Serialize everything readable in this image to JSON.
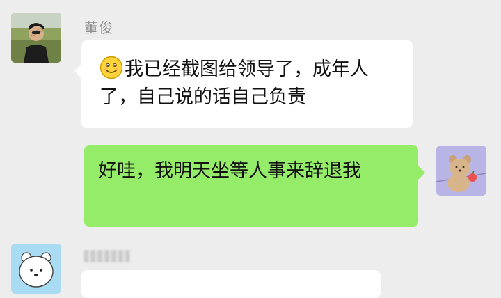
{
  "chat": {
    "messages": [
      {
        "sender": "董俊",
        "direction": "incoming",
        "avatar": "man-photo-avatar",
        "emoji": "smiley-face-icon",
        "text": "我已经截图给领导了，成年人了，自己说的话自己负责"
      },
      {
        "direction": "outgoing",
        "avatar": "bear-sticker-avatar",
        "text": "好哇，我明天坐等人事来辞退我"
      },
      {
        "sender": "",
        "sender_blurred": true,
        "direction": "incoming",
        "avatar": "polar-bear-avatar",
        "text": ""
      }
    ]
  },
  "colors": {
    "background": "#ededed",
    "incoming_bubble": "#ffffff",
    "outgoing_bubble": "#95ec69",
    "sender_name": "#8b8b8b",
    "text": "#111111"
  }
}
